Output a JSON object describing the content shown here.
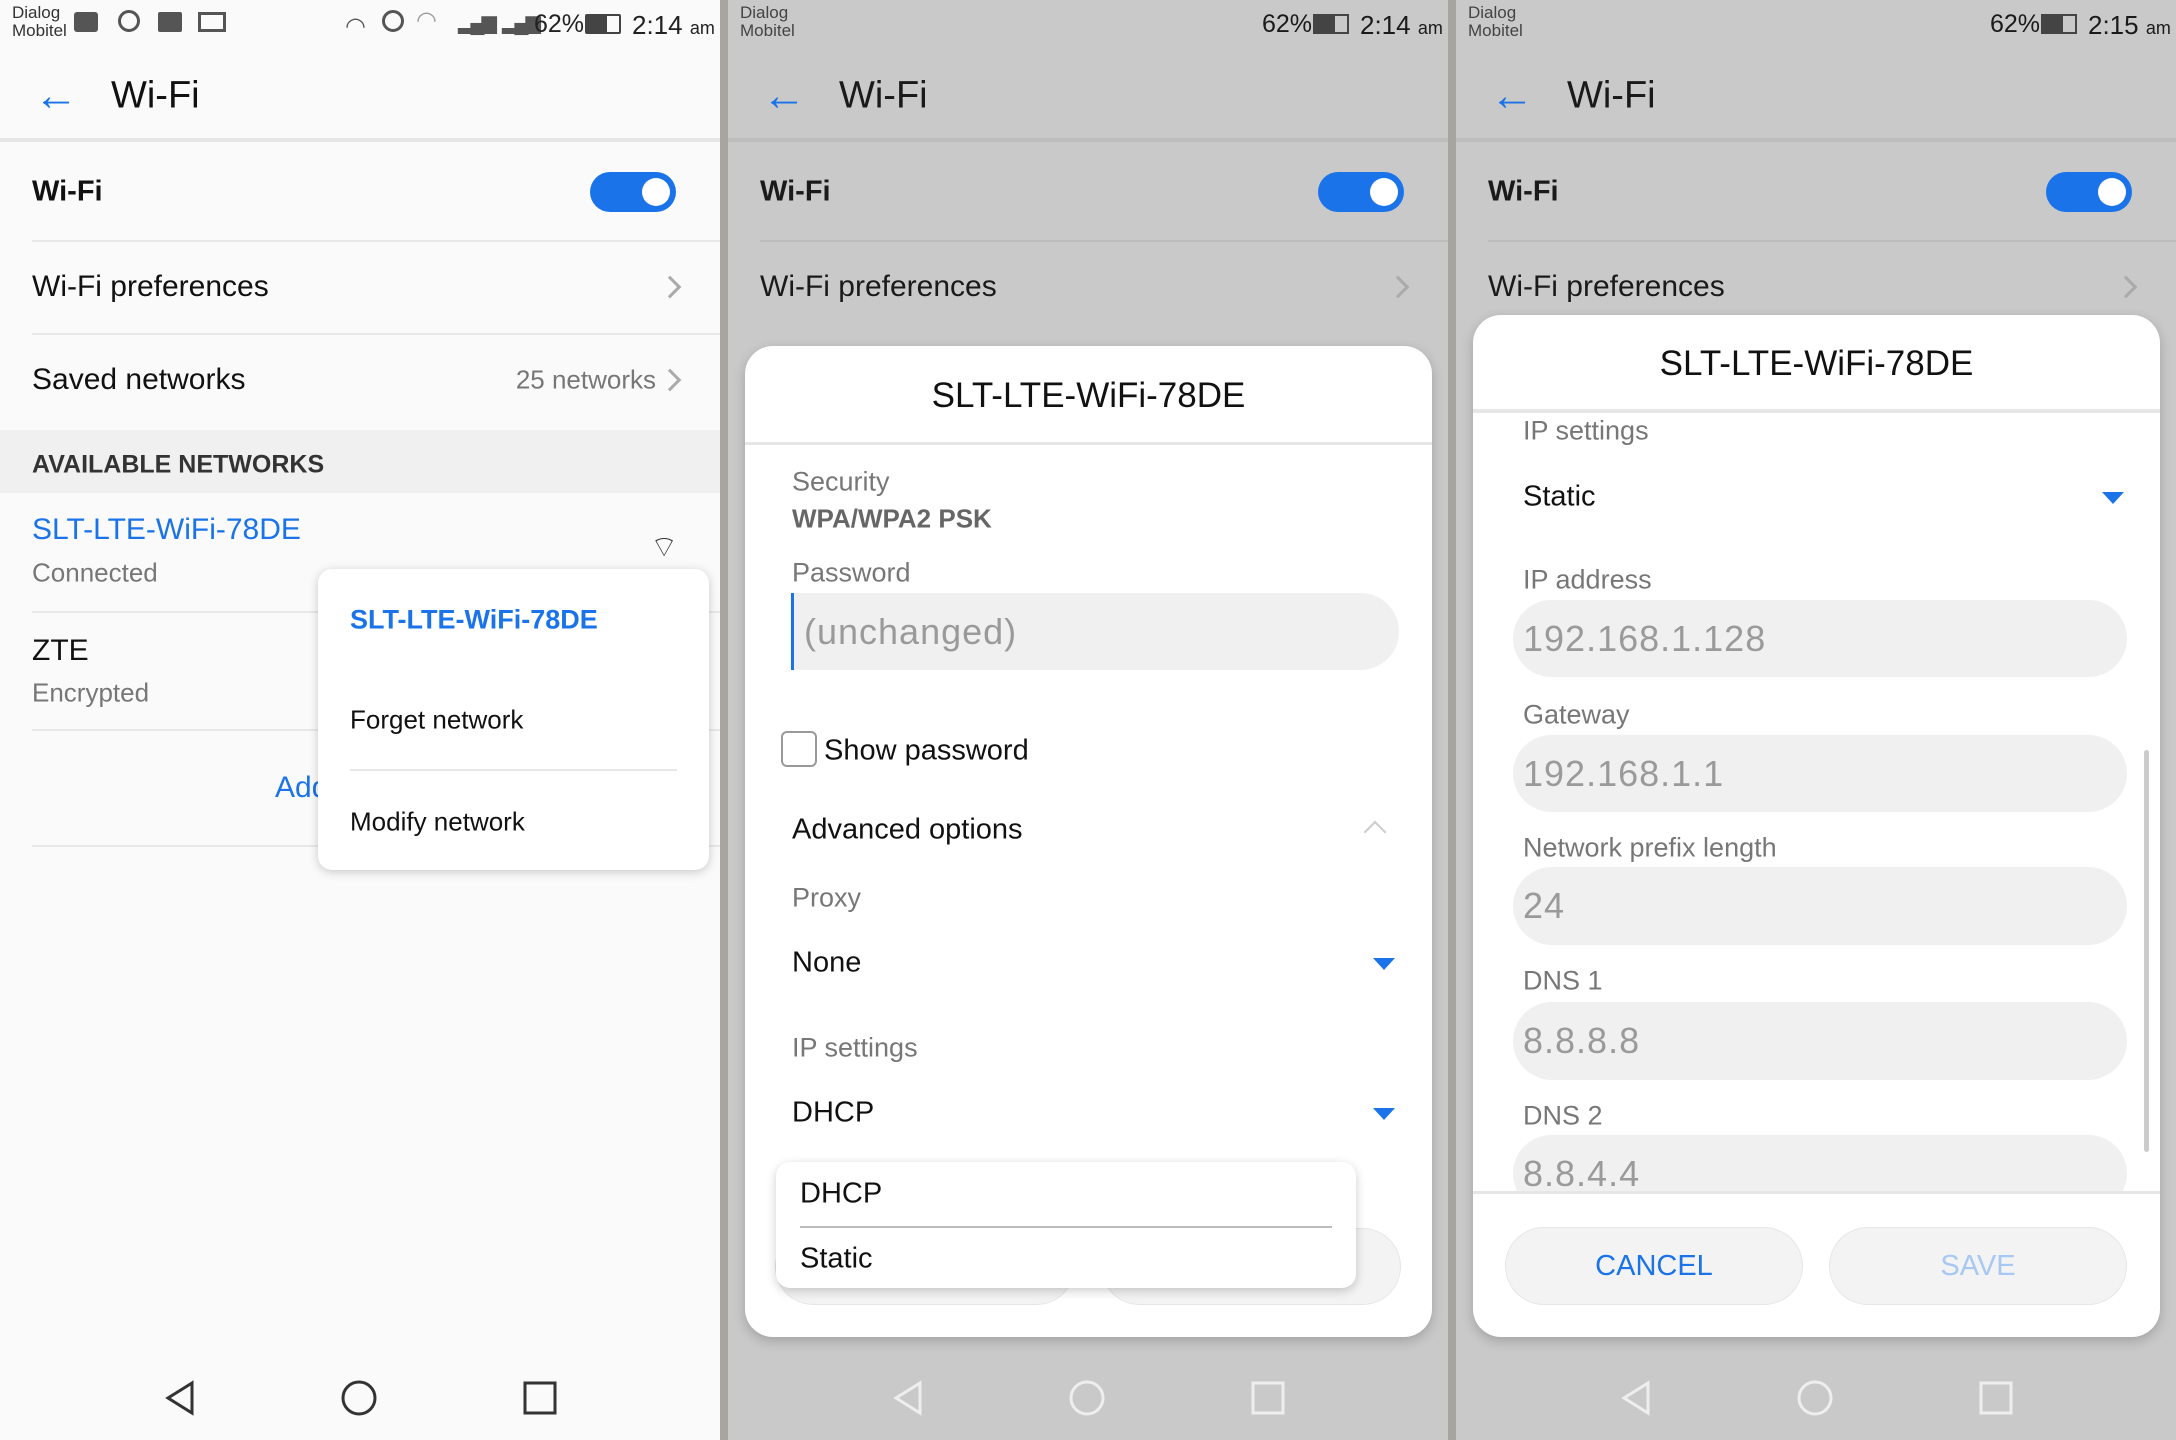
{
  "status_bar": {
    "carrier_line1": "Dialog",
    "carrier_line2": "Mobitel",
    "battery": "62%",
    "times": [
      "2:14",
      "2:14",
      "2:15"
    ],
    "ampm": "am"
  },
  "header": {
    "title": "Wi-Fi"
  },
  "settings": {
    "wifi_label": "Wi-Fi",
    "wifi_enabled": true,
    "preferences_label": "Wi-Fi preferences",
    "saved_label": "Saved networks",
    "saved_count": "25 networks",
    "available_header": "AVAILABLE NETWORKS",
    "networks": [
      {
        "name": "SLT-LTE-WiFi-78DE",
        "status": "Connected"
      },
      {
        "name": "ZTE",
        "status": "Encrypted"
      }
    ],
    "add_network_partial": "Add"
  },
  "context_menu": {
    "title": "SLT-LTE-WiFi-78DE",
    "items": [
      "Forget network",
      "Modify network"
    ]
  },
  "modify_dialog": {
    "title": "SLT-LTE-WiFi-78DE",
    "security_label": "Security",
    "security_value": "WPA/WPA2 PSK",
    "password_label": "Password",
    "password_placeholder": "(unchanged)",
    "show_password": "Show password",
    "show_password_checked": false,
    "advanced_options": "Advanced options",
    "proxy_label": "Proxy",
    "proxy_value": "None",
    "ip_settings_label": "IP settings",
    "ip_settings_value": "DHCP",
    "ip_options": [
      "DHCP",
      "Static"
    ]
  },
  "static_dialog": {
    "title": "SLT-LTE-WiFi-78DE",
    "ip_settings_label": "IP settings",
    "ip_settings_value": "Static",
    "ip_address_label": "IP address",
    "ip_address": "192.168.1.128",
    "gateway_label": "Gateway",
    "gateway": "192.168.1.1",
    "prefix_label": "Network prefix length",
    "prefix": "24",
    "dns1_label": "DNS 1",
    "dns1": "8.8.8.8",
    "dns2_label": "DNS 2",
    "dns2": "8.8.4.4",
    "cancel": "CANCEL",
    "save": "SAVE"
  },
  "colors": {
    "accent": "#1a73e8",
    "overlay": "#c9c9c9"
  }
}
